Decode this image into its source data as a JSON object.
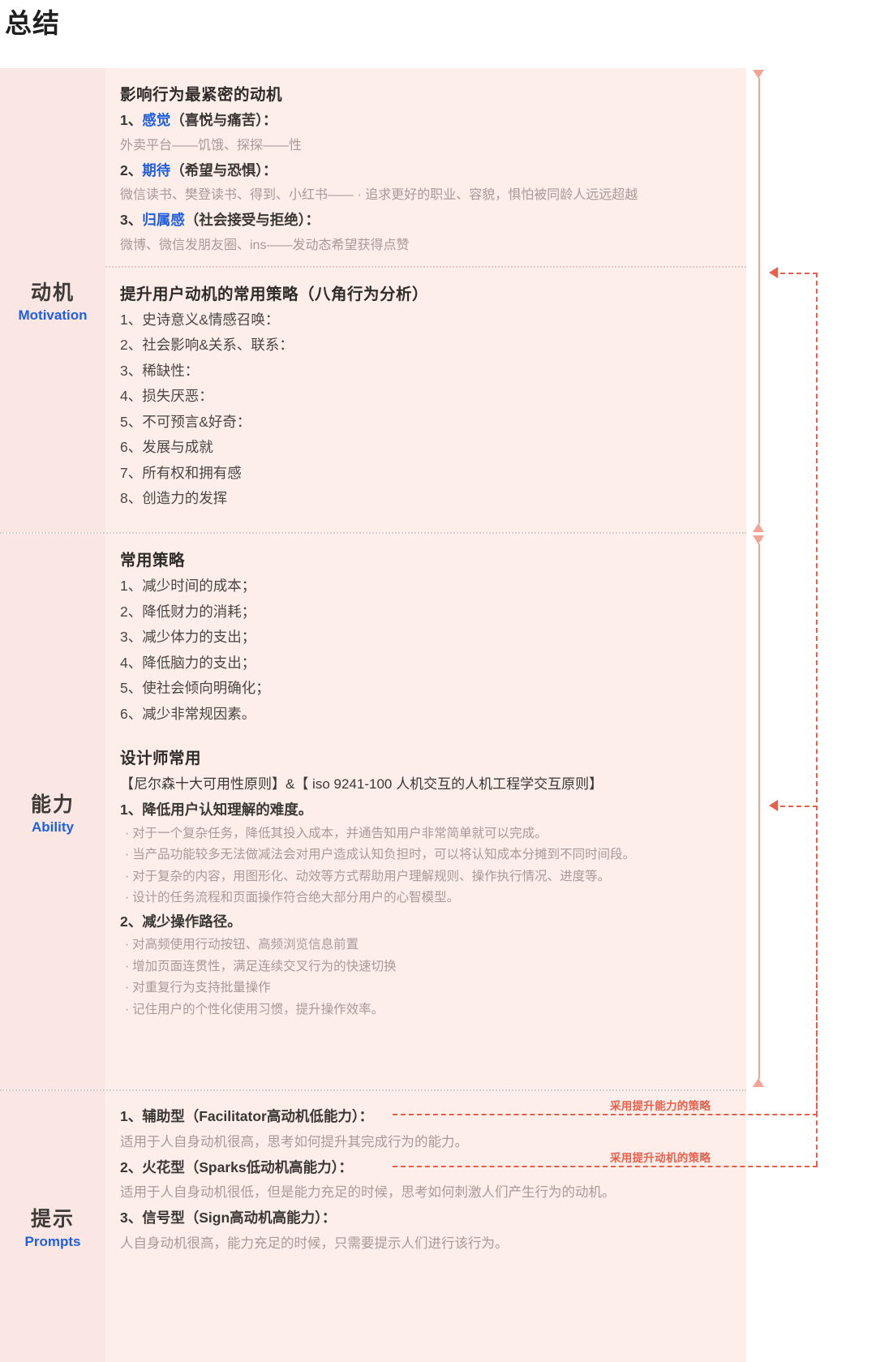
{
  "page": {
    "title": "总结"
  },
  "colors": {
    "accent_blue": "#1f5fe0",
    "annotation_red": "#e8604c",
    "panel_bg": "#fdeeea",
    "label_bg": "#fae6e3",
    "muted_text": "#a89a96",
    "divider": "#e3c8c4",
    "salmon": "#f3a393"
  },
  "rows": [
    {
      "label_cn": "动机",
      "label_en": "Motivation",
      "blocks": [
        {
          "title": "影响行为最紧密的动机",
          "items": [
            {
              "num": "1、",
              "keyword": "感觉",
              "rest": "（喜悦与痛苦）："
            },
            {
              "example": "外卖平台——饥饿、探探——性"
            },
            {
              "num": "2、",
              "keyword": "期待",
              "rest": "（希望与恐惧）："
            },
            {
              "example": "微信读书、樊登读书、得到、小红书—— · 追求更好的职业、容貌，惧怕被同龄人远远超越"
            },
            {
              "num": "3、",
              "keyword": "归属感",
              "rest": "（社会接受与拒绝）："
            },
            {
              "example": "微博、微信发朋友圈、ins——发动态希望获得点赞"
            }
          ]
        },
        {
          "title": "提升用户动机的常用策略（八角行为分析）",
          "items": [
            {
              "num": "1、",
              "rest": "史诗意义&情感召唤："
            },
            {
              "num": "2、",
              "rest": "社会影响&关系、联系："
            },
            {
              "num": "3、",
              "rest": "稀缺性："
            },
            {
              "num": "4、",
              "rest": "损失厌恶："
            },
            {
              "num": "5、",
              "rest": "不可预言&好奇："
            },
            {
              "num": "6、",
              "rest": "发展与成就"
            },
            {
              "num": "7、",
              "rest": "所有权和拥有感"
            },
            {
              "num": "8、",
              "rest": "创造力的发挥"
            }
          ]
        }
      ]
    },
    {
      "label_cn": "能力",
      "label_en": "Ability",
      "blocks": [
        {
          "title": "常用策略",
          "items": [
            {
              "num": "1、",
              "rest": "减少时间的成本；"
            },
            {
              "num": "2、",
              "rest": "降低财力的消耗；"
            },
            {
              "num": "3、",
              "rest": "减少体力的支出；"
            },
            {
              "num": "4、",
              "rest": "降低脑力的支出；"
            },
            {
              "num": "5、",
              "rest": "使社会倾向明确化；"
            },
            {
              "num": "6、",
              "rest": "减少非常规因素。"
            }
          ]
        },
        {
          "title": "设计师常用",
          "iso": "【尼尔森十大可用性原则】&【 iso 9241-100 人机交互的人机工程学交互原则】",
          "groups": [
            {
              "heading": "1、降低用户认知理解的难度。",
              "bullets": [
                "对于一个复杂任务，降低其投入成本，并通告知用户非常简单就可以完成。",
                "当产品功能较多无法做减法会对用户造成认知负担时，可以将认知成本分摊到不同时间段。",
                "对于复杂的内容，用图形化、动效等方式帮助用户理解规则、操作执行情况、进度等。",
                "设计的任务流程和页面操作符合绝大部分用户的心智模型。"
              ]
            },
            {
              "heading": "2、减少操作路径。",
              "bullets": [
                "对高频使用行动按钮、高频浏览信息前置",
                "增加页面连贯性，满足连续交叉行为的快速切换",
                "对重复行为支持批量操作",
                "记住用户的个性化使用习惯，提升操作效率。"
              ]
            }
          ]
        }
      ]
    },
    {
      "label_cn": "提示",
      "label_en": "Prompts",
      "blocks": [
        {
          "items": [
            {
              "num": "1、",
              "rest": "辅助型（Facilitator高动机低能力）："
            },
            {
              "example": "适用于人自身动机很高，思考如何提升其完成行为的能力。"
            },
            {
              "num": "2、",
              "rest": "火花型（Sparks低动机高能力）："
            },
            {
              "example": "适用于人自身动机很低，但是能力充足的时候，思考如何刺激人们产生行为的动机。"
            },
            {
              "num": "3、",
              "rest": "信号型（Sign高动机高能力）："
            },
            {
              "example": "人自身动机很高，能力充足的时候，只需要提示人们进行该行为。"
            }
          ]
        }
      ]
    }
  ],
  "annotations": [
    {
      "text": "采用提升能力的策略"
    },
    {
      "text": "采用提升动机的策略"
    }
  ]
}
